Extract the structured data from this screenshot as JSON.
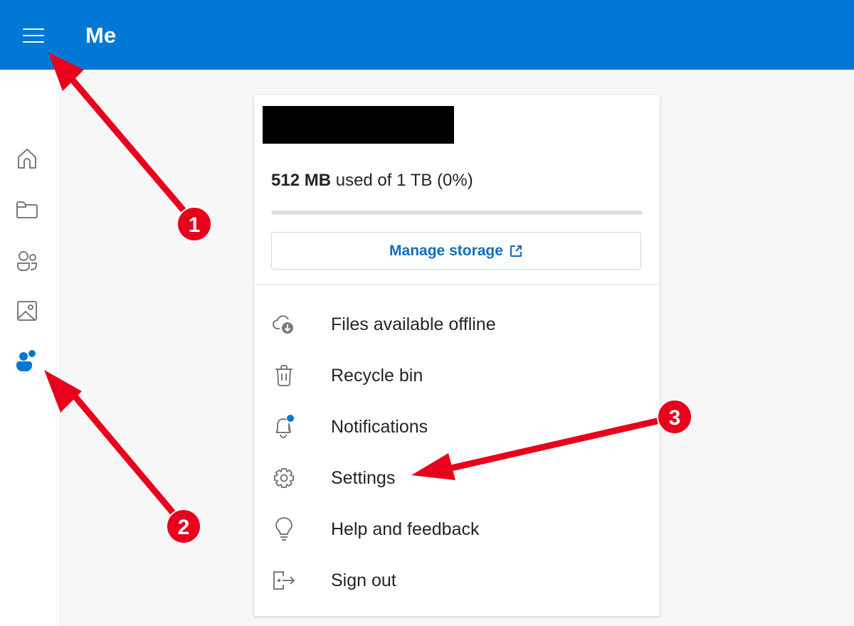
{
  "header": {
    "title": "Me",
    "menu_icon": "hamburger-icon"
  },
  "sidebar": {
    "items": [
      {
        "name": "home",
        "icon": "home-icon"
      },
      {
        "name": "files",
        "icon": "folder-icon"
      },
      {
        "name": "shared",
        "icon": "people-icon"
      },
      {
        "name": "photos",
        "icon": "image-icon"
      },
      {
        "name": "me",
        "icon": "person-filled-icon",
        "active": true
      }
    ]
  },
  "account": {
    "name_redacted": true,
    "usage_bold": "512 MB",
    "usage_rest": " used of 1 TB (0%)",
    "usage_percent": 0,
    "manage_storage_label": "Manage storage",
    "manage_storage_icon": "external-link-icon"
  },
  "menu": {
    "items": [
      {
        "label": "Files available offline",
        "icon": "cloud-download-icon"
      },
      {
        "label": "Recycle bin",
        "icon": "trash-icon"
      },
      {
        "label": "Notifications",
        "icon": "bell-icon",
        "badge": true
      },
      {
        "label": "Settings",
        "icon": "gear-icon"
      },
      {
        "label": "Help and feedback",
        "icon": "lightbulb-icon"
      },
      {
        "label": "Sign out",
        "icon": "sign-out-icon"
      }
    ]
  },
  "annotations": [
    {
      "number": "1",
      "target": "hamburger-menu"
    },
    {
      "number": "2",
      "target": "me-nav"
    },
    {
      "number": "3",
      "target": "settings"
    }
  ],
  "colors": {
    "brand": "#0078d4",
    "annotation": "#e8001c",
    "link": "#106ebe"
  }
}
